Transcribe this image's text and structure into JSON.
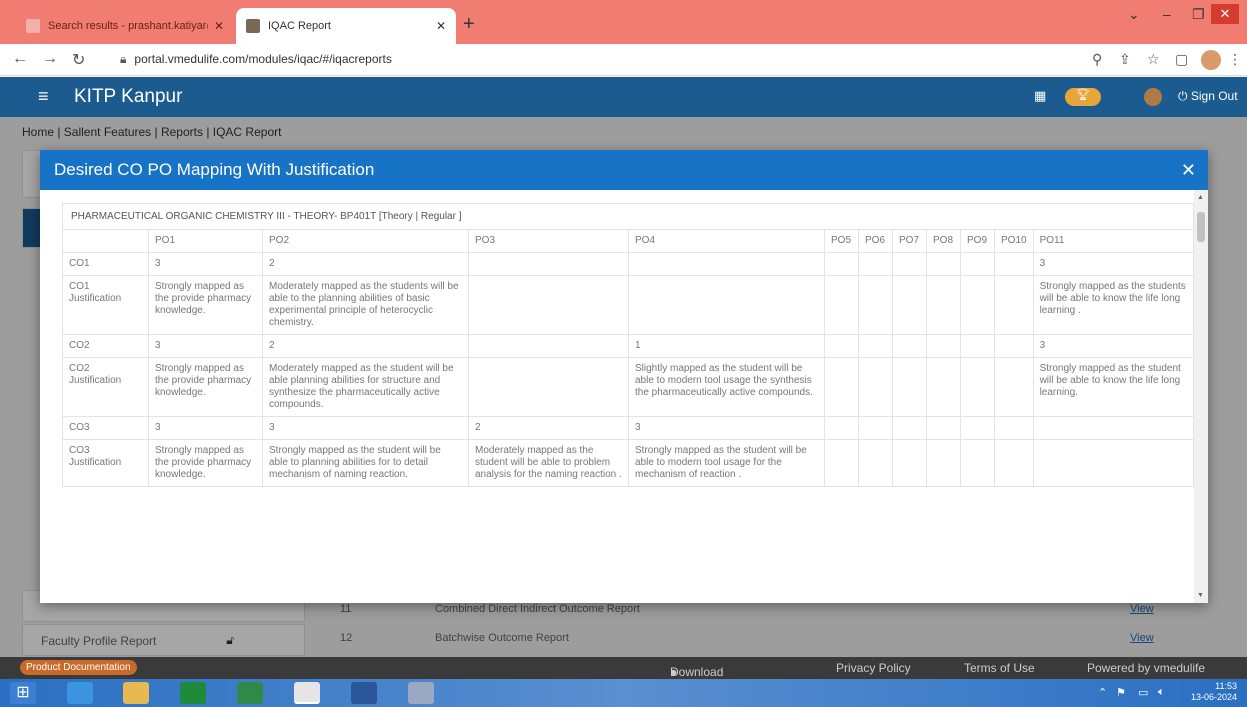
{
  "browser": {
    "tabs": [
      {
        "title": "Search results - prashant.katiyar@"
      },
      {
        "title": "IQAC Report"
      }
    ],
    "url": "portal.vmedulife.com/modules/iqac/#/iqacreports"
  },
  "app": {
    "brand": "KITP Kanpur",
    "sign_out": "Sign Out",
    "breadcrumb": "Home | Sallent Features | Reports | IQAC Report"
  },
  "background": {
    "faculty_profile_report": "Faculty Profile Report",
    "rows": [
      {
        "num": "11",
        "name": "Combined Direct Indirect Outcome Report",
        "action": "View"
      },
      {
        "num": "12",
        "name": "Batchwise Outcome Report",
        "action": "View"
      }
    ]
  },
  "footer": {
    "product_documentation": "Product Documentation",
    "download_app": "Download App",
    "privacy_policy": "Privacy Policy",
    "terms": "Terms of Use",
    "powered_by": "Powered by vmedulife"
  },
  "taskbar": {
    "time": "11:53",
    "date": "13-06-2024"
  },
  "modal": {
    "title": "Desired CO PO Mapping With Justification",
    "course": "PHARMACEUTICAL ORGANIC CHEMISTRY III - THEORY- BP401T [Theory | Regular ]",
    "headers": [
      "",
      "PO1",
      "PO2",
      "PO3",
      "PO4",
      "PO5",
      "PO6",
      "PO7",
      "PO8",
      "PO9",
      "PO10",
      "PO11"
    ],
    "rows": [
      [
        "CO1",
        "3",
        "2",
        "",
        "",
        "",
        "",
        "",
        "",
        "",
        "",
        "3"
      ],
      [
        "CO1 Justification",
        "Strongly mapped as the provide pharmacy knowledge.",
        "Moderately mapped as the students will be able to the planning abilities of basic experimental principle of heterocyclic chemistry.",
        "",
        "",
        "",
        "",
        "",
        "",
        "",
        "",
        "Strongly mapped as the students will be able to know the life long learning ."
      ],
      [
        "CO2",
        "3",
        "2",
        "",
        "1",
        "",
        "",
        "",
        "",
        "",
        "",
        "3"
      ],
      [
        "CO2 Justification",
        "Strongly mapped as the provide pharmacy knowledge.",
        "Moderately mapped as the student will be able planning abilities for structure and synthesize the pharmaceutically active compounds.",
        "",
        "Slightly mapped as the student will be able to modern tool usage the synthesis the pharmaceutically active compounds.",
        "",
        "",
        "",
        "",
        "",
        "",
        "Strongly mapped as the student will be able to know the life long learning."
      ],
      [
        "CO3",
        "3",
        "3",
        "2",
        "3",
        "",
        "",
        "",
        "",
        "",
        "",
        ""
      ],
      [
        "CO3 Justification",
        "Strongly mapped as the provide pharmacy knowledge.",
        "Strongly mapped as the student will be able to planning abilities for to detail mechanism of naming reaction.",
        "Moderately mapped as the student will be able to problem analysis for the naming reaction .",
        "Strongly mapped as the student will be able to modern tool usage for the mechanism of reaction .",
        "",
        "",
        "",
        "",
        "",
        "",
        ""
      ]
    ]
  }
}
